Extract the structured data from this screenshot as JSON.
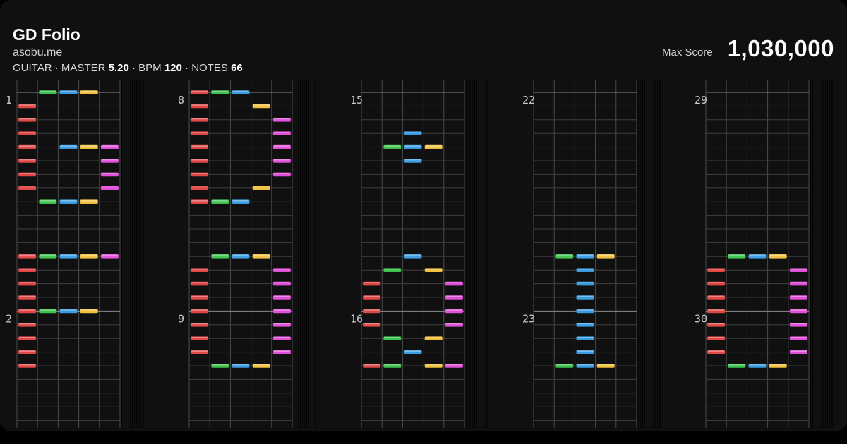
{
  "header": {
    "title": "GD Folio",
    "site": "asobu.me",
    "instrument": "GUITAR",
    "difficulty_label": "MASTER",
    "difficulty_value": "5.20",
    "bpm_label": "BPM",
    "bpm_value": "120",
    "notes_label": "NOTES",
    "notes_value": "66",
    "separator": " · ",
    "max_score_label": "Max Score",
    "max_score_value": "1,030,000"
  },
  "colors": {
    "background": "#000000",
    "grid": "#4a4a4a",
    "lane0": "#e04848",
    "lane1": "#3ec24e",
    "lane2": "#3a9be0",
    "lane3": "#f0c040",
    "lane4": "#e050d8"
  },
  "chart_data": {
    "type": "table",
    "lanes": 5,
    "rows_per_measure": 16,
    "columns": [
      {
        "measures": [
          1,
          2
        ],
        "notes": [
          [
            0,
            1
          ],
          [
            0,
            2
          ],
          [
            0,
            3
          ],
          [
            1,
            0
          ],
          [
            2,
            0
          ],
          [
            3,
            0
          ],
          [
            4,
            0
          ],
          [
            4,
            2
          ],
          [
            4,
            3
          ],
          [
            4,
            4
          ],
          [
            5,
            0
          ],
          [
            5,
            4
          ],
          [
            6,
            0
          ],
          [
            6,
            4
          ],
          [
            7,
            0
          ],
          [
            7,
            4
          ],
          [
            8,
            1
          ],
          [
            8,
            2
          ],
          [
            8,
            3
          ],
          [
            12,
            0
          ],
          [
            12,
            1
          ],
          [
            12,
            2
          ],
          [
            12,
            3
          ],
          [
            12,
            4
          ],
          [
            13,
            0
          ],
          [
            14,
            0
          ],
          [
            15,
            0
          ],
          [
            16,
            0
          ],
          [
            16,
            1
          ],
          [
            16,
            2
          ],
          [
            16,
            3
          ],
          [
            17,
            0
          ],
          [
            18,
            0
          ],
          [
            19,
            0
          ],
          [
            20,
            0
          ]
        ]
      },
      {
        "measures": [
          8,
          9
        ],
        "notes": [
          [
            0,
            0
          ],
          [
            0,
            1
          ],
          [
            0,
            2
          ],
          [
            1,
            0
          ],
          [
            1,
            3
          ],
          [
            2,
            0
          ],
          [
            2,
            4
          ],
          [
            3,
            0
          ],
          [
            3,
            4
          ],
          [
            4,
            0
          ],
          [
            4,
            4
          ],
          [
            5,
            0
          ],
          [
            5,
            4
          ],
          [
            6,
            0
          ],
          [
            6,
            4
          ],
          [
            7,
            0
          ],
          [
            7,
            3
          ],
          [
            8,
            0
          ],
          [
            8,
            1
          ],
          [
            8,
            2
          ],
          [
            12,
            1
          ],
          [
            12,
            2
          ],
          [
            12,
            3
          ],
          [
            13,
            0
          ],
          [
            13,
            4
          ],
          [
            14,
            0
          ],
          [
            14,
            4
          ],
          [
            15,
            0
          ],
          [
            15,
            4
          ],
          [
            16,
            0
          ],
          [
            16,
            4
          ],
          [
            17,
            0
          ],
          [
            17,
            4
          ],
          [
            18,
            0
          ],
          [
            18,
            4
          ],
          [
            19,
            0
          ],
          [
            19,
            4
          ],
          [
            20,
            1
          ],
          [
            20,
            2
          ],
          [
            20,
            3
          ]
        ]
      },
      {
        "measures": [
          15,
          16
        ],
        "notes": [
          [
            3,
            2
          ],
          [
            4,
            1
          ],
          [
            4,
            2
          ],
          [
            4,
            3
          ],
          [
            5,
            2
          ],
          [
            12,
            2
          ],
          [
            13,
            1
          ],
          [
            13,
            3
          ],
          [
            14,
            0
          ],
          [
            14,
            4
          ],
          [
            15,
            0
          ],
          [
            15,
            4
          ],
          [
            16,
            0
          ],
          [
            16,
            4
          ],
          [
            17,
            0
          ],
          [
            17,
            4
          ],
          [
            18,
            1
          ],
          [
            18,
            3
          ],
          [
            19,
            2
          ],
          [
            20,
            0
          ],
          [
            20,
            1
          ],
          [
            20,
            3
          ],
          [
            20,
            4
          ]
        ]
      },
      {
        "measures": [
          22,
          23
        ],
        "notes": [
          [
            12,
            1
          ],
          [
            12,
            2
          ],
          [
            12,
            3
          ],
          [
            13,
            2
          ],
          [
            14,
            2
          ],
          [
            15,
            2
          ],
          [
            16,
            2
          ],
          [
            17,
            2
          ],
          [
            18,
            2
          ],
          [
            19,
            2
          ],
          [
            20,
            1
          ],
          [
            20,
            2
          ],
          [
            20,
            3
          ]
        ]
      },
      {
        "measures": [
          29,
          30
        ],
        "notes": [
          [
            12,
            1
          ],
          [
            12,
            2
          ],
          [
            12,
            3
          ],
          [
            13,
            0
          ],
          [
            13,
            4
          ],
          [
            14,
            0
          ],
          [
            14,
            4
          ],
          [
            15,
            0
          ],
          [
            15,
            4
          ],
          [
            16,
            0
          ],
          [
            16,
            4
          ],
          [
            17,
            0
          ],
          [
            17,
            4
          ],
          [
            18,
            0
          ],
          [
            18,
            4
          ],
          [
            19,
            0
          ],
          [
            19,
            4
          ],
          [
            20,
            1
          ],
          [
            20,
            2
          ],
          [
            20,
            3
          ]
        ]
      }
    ]
  }
}
